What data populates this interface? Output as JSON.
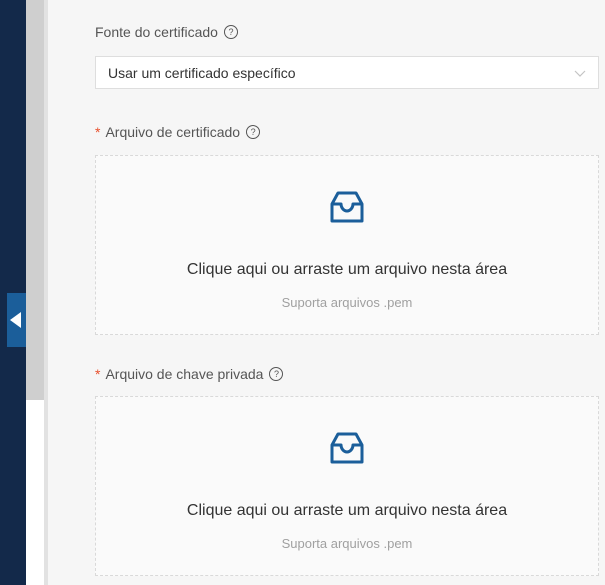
{
  "colors": {
    "nav": "#13294a",
    "accent": "#1b5e9a",
    "required": "#e8502d",
    "hint": "#a0a0a0"
  },
  "certificate_source": {
    "label": "Fonte do certificado",
    "help_icon": "question-circle-icon",
    "selected_value": "Usar um certificado específico"
  },
  "certificate_file": {
    "required_mark": "*",
    "label": "Arquivo de certificado",
    "help_icon": "question-circle-icon",
    "upload_icon": "inbox-icon",
    "drop_text": "Clique aqui ou arraste um arquivo nesta área",
    "hint": "Suporta arquivos .pem"
  },
  "private_key_file": {
    "required_mark": "*",
    "label": "Arquivo de chave privada",
    "help_icon": "question-circle-icon",
    "upload_icon": "inbox-icon",
    "drop_text": "Clique aqui ou arraste um arquivo nesta área",
    "hint": "Suporta arquivos .pem"
  }
}
